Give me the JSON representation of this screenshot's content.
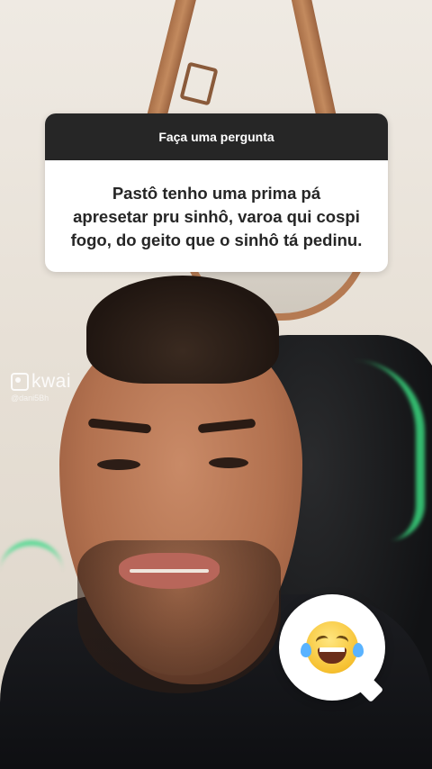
{
  "question_card": {
    "header": "Faça uma pergunta",
    "lines": [
      "Pastô tenho uma prima  pá",
      "apresetar pru sinhô, varoa qui cospi",
      "fogo, do geito que o sinhô tá pedinu."
    ]
  },
  "watermark": {
    "brand": "kwai",
    "handle": "@dani5Bh"
  },
  "reaction_sticker": {
    "emoji": "face-with-tears-of-joy-icon"
  },
  "colors": {
    "card_header_bg": "#262626",
    "card_bg": "#ffffff",
    "chair_led": "#39d77e",
    "mirror_frame": "#b57a52"
  }
}
